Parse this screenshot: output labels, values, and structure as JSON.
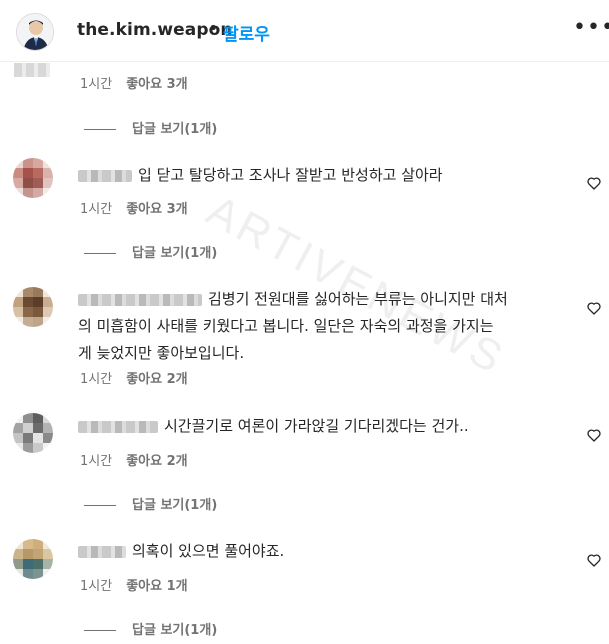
{
  "header": {
    "username": "the.kim.weapon",
    "separator": "•",
    "follow_label": "팔로우",
    "more_label": "•••"
  },
  "watermark": "ARTIVENEWS",
  "comments": [
    {
      "text": "",
      "time": "1시간",
      "likes": "좋아요 3개",
      "replies": "답글 보기(1개)"
    },
    {
      "text": "입 닫고 탈당하고 조사나 잘받고 반성하고 살아라",
      "time": "1시간",
      "likes": "좋아요 3개",
      "replies": "답글 보기(1개)"
    },
    {
      "text": "김병기 전원대를 싫어하는 부류는 아니지만 대처의 미흡함이 사태를 키웠다고 봅니다. 일단은 자숙의 과정을 가지는게 늦었지만 좋아보입니다.",
      "line1": "김병기 전원대를 싫어하는 부류는 아니지만 대처",
      "line2": "의 미흡함이 사태를 키웠다고 봅니다. 일단은 자숙의 과정을 가지는",
      "line3": "게 늦었지만 좋아보입니다.",
      "time": "1시간",
      "likes": "좋아요 2개"
    },
    {
      "text": "시간끌기로 여론이 가라앉길 기다리겠다는 건가..",
      "time": "1시간",
      "likes": "좋아요 2개",
      "replies": "답글 보기(1개)"
    },
    {
      "text": "의혹이 있으면 풀어야죠.",
      "time": "1시간",
      "likes": "좋아요 1개",
      "replies": "답글 보기(1개)"
    }
  ],
  "icons": {
    "heart": "heart-outline-icon",
    "more": "more-horizontal-icon"
  }
}
